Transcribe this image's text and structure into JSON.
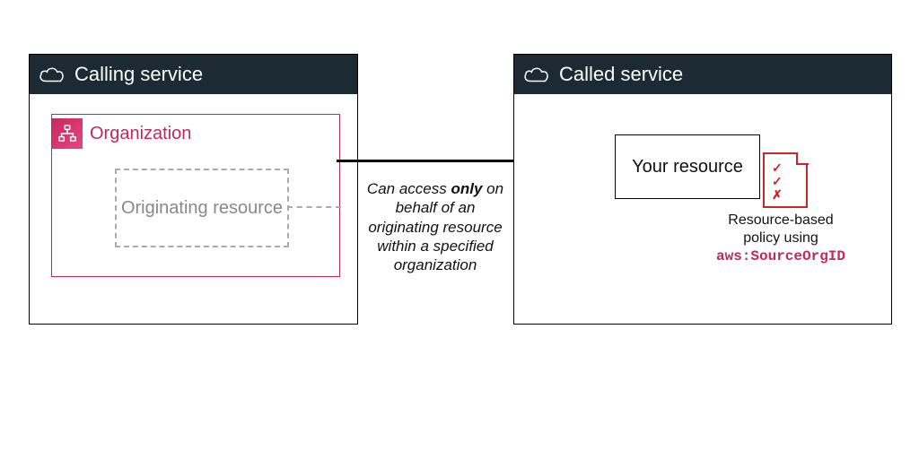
{
  "left_panel": {
    "title": "Calling service",
    "organization": {
      "label": "Organization",
      "originating_label": "Originating resource"
    }
  },
  "right_panel": {
    "title": "Called service",
    "resource_label": "Your resource",
    "policy_caption_line1": "Resource-based",
    "policy_caption_line2": "policy using",
    "policy_key": "aws:SourceOrgID"
  },
  "arrow_caption": {
    "pre": "Can access ",
    "bold": "only",
    "post": " on behalf of an originating resource within a specified organization"
  },
  "icons": {
    "cloud": "cloud-icon",
    "org": "org-hierarchy-icon",
    "policy_checks": "✓\n✓\n✗"
  }
}
